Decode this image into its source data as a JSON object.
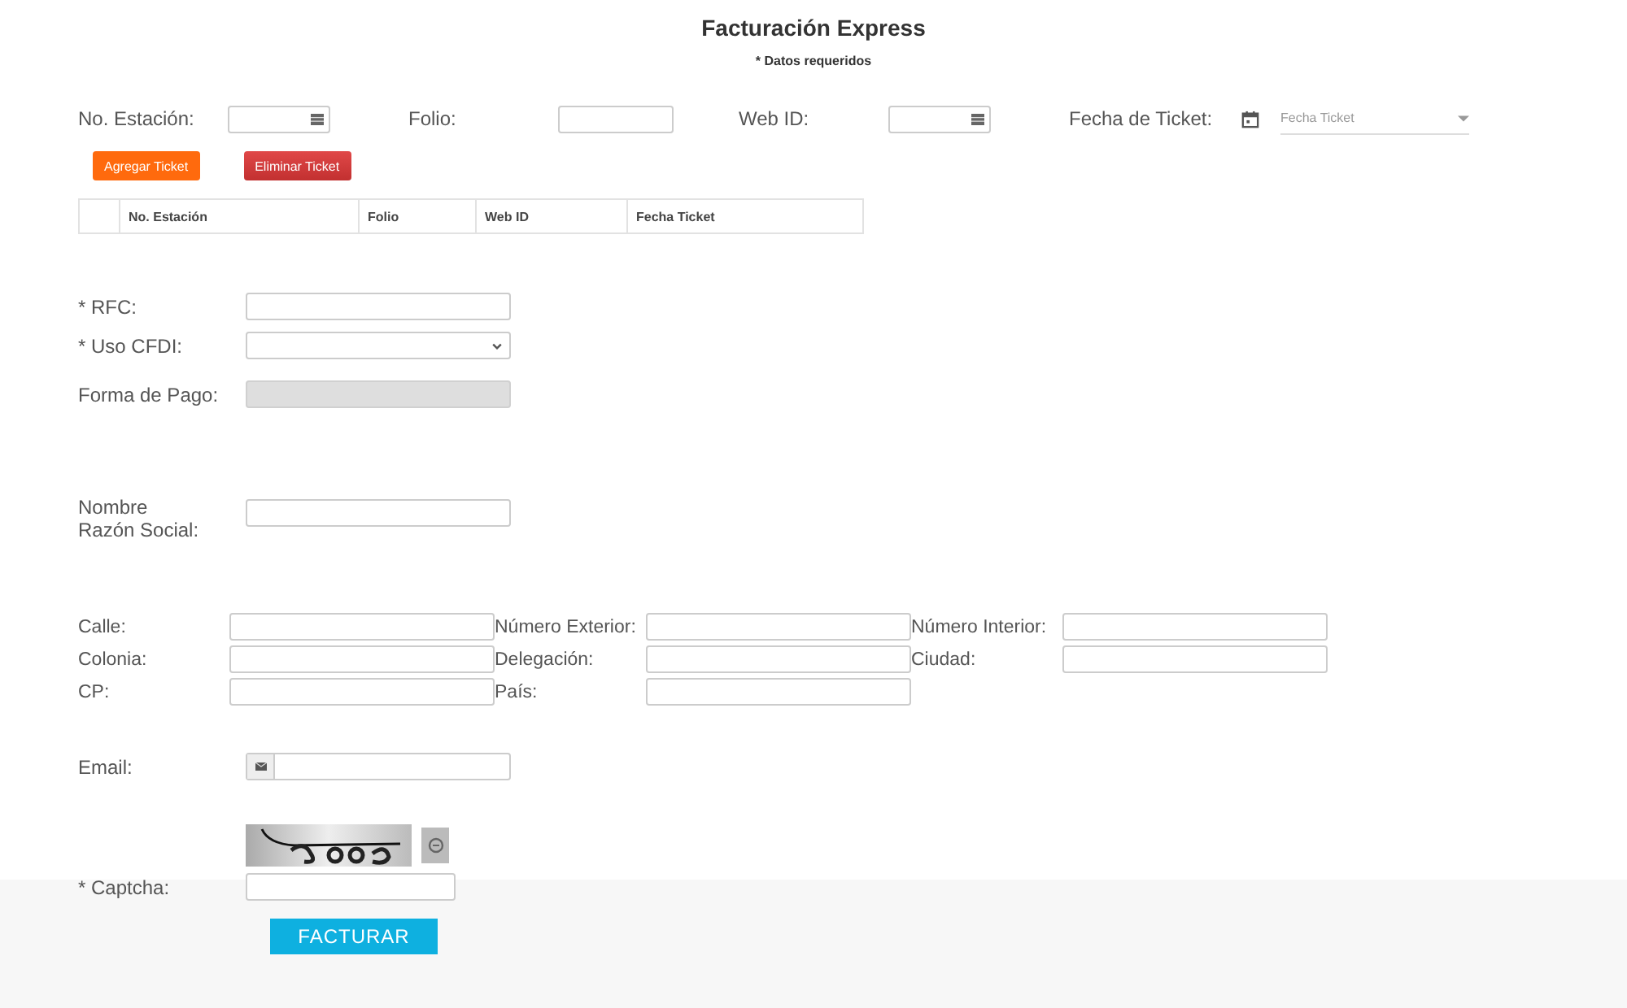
{
  "title": "Facturación Express",
  "required_note": "* Datos requeridos",
  "ticket_fields": [
    {
      "label": "No. Estación:",
      "kind": "numeric"
    },
    {
      "label": "Folio:",
      "kind": "text"
    },
    {
      "label": "Web ID:",
      "kind": "numeric"
    },
    {
      "label": "Fecha de Ticket:",
      "kind": "date",
      "placeholder": "Fecha Ticket"
    }
  ],
  "ticket_buttons": [
    {
      "label": "Agregar Ticket",
      "kind": "add"
    },
    {
      "label": "Eliminar Ticket",
      "kind": "remove"
    }
  ],
  "ticket_table": {
    "columns": [
      "No. Estación",
      "Folio",
      "Web ID",
      "Fecha Ticket"
    ]
  },
  "customer_fields": [
    {
      "label": "* RFC:",
      "kind": "text",
      "disabled": false
    },
    {
      "label": "* Uso CFDI:",
      "kind": "select",
      "disabled": false
    },
    {
      "label": "Forma de Pago:",
      "kind": "text",
      "disabled": true
    }
  ],
  "business_name": {
    "label": "Nombre Razón Social:"
  },
  "address_fields": [
    {
      "label": "Calle:"
    },
    {
      "label": "Número Exterior:"
    },
    {
      "label": "Número Interior:"
    },
    {
      "label": "Colonia:"
    },
    {
      "label": "Delegación:"
    },
    {
      "label": "Ciudad:"
    },
    {
      "label": "CP:"
    },
    {
      "label": "País:"
    }
  ],
  "email": {
    "label": "Email:"
  },
  "captcha": {
    "label": "* Captcha:"
  },
  "submit": "FACTURAR"
}
